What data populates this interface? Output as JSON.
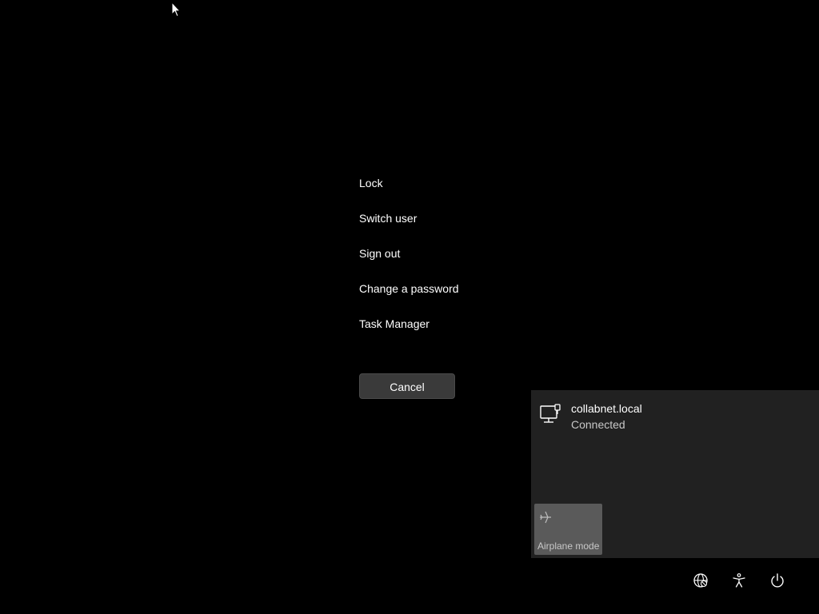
{
  "menu": {
    "items": [
      {
        "label": "Lock"
      },
      {
        "label": "Switch user"
      },
      {
        "label": "Sign out"
      },
      {
        "label": "Change a password"
      },
      {
        "label": "Task Manager"
      }
    ],
    "cancel_label": "Cancel"
  },
  "network": {
    "name": "collabnet.local",
    "status": "Connected",
    "icon": "wired-network-icon"
  },
  "quick_actions": {
    "airplane_mode": {
      "label": "Airplane mode",
      "icon": "airplane-icon"
    }
  },
  "system_tray": {
    "icons": [
      "network-globe-icon",
      "accessibility-icon",
      "power-icon"
    ]
  },
  "colors": {
    "background": "#000000",
    "panel": "#212121",
    "button": "#3a3a3a",
    "tile": "#5a5a5a"
  }
}
